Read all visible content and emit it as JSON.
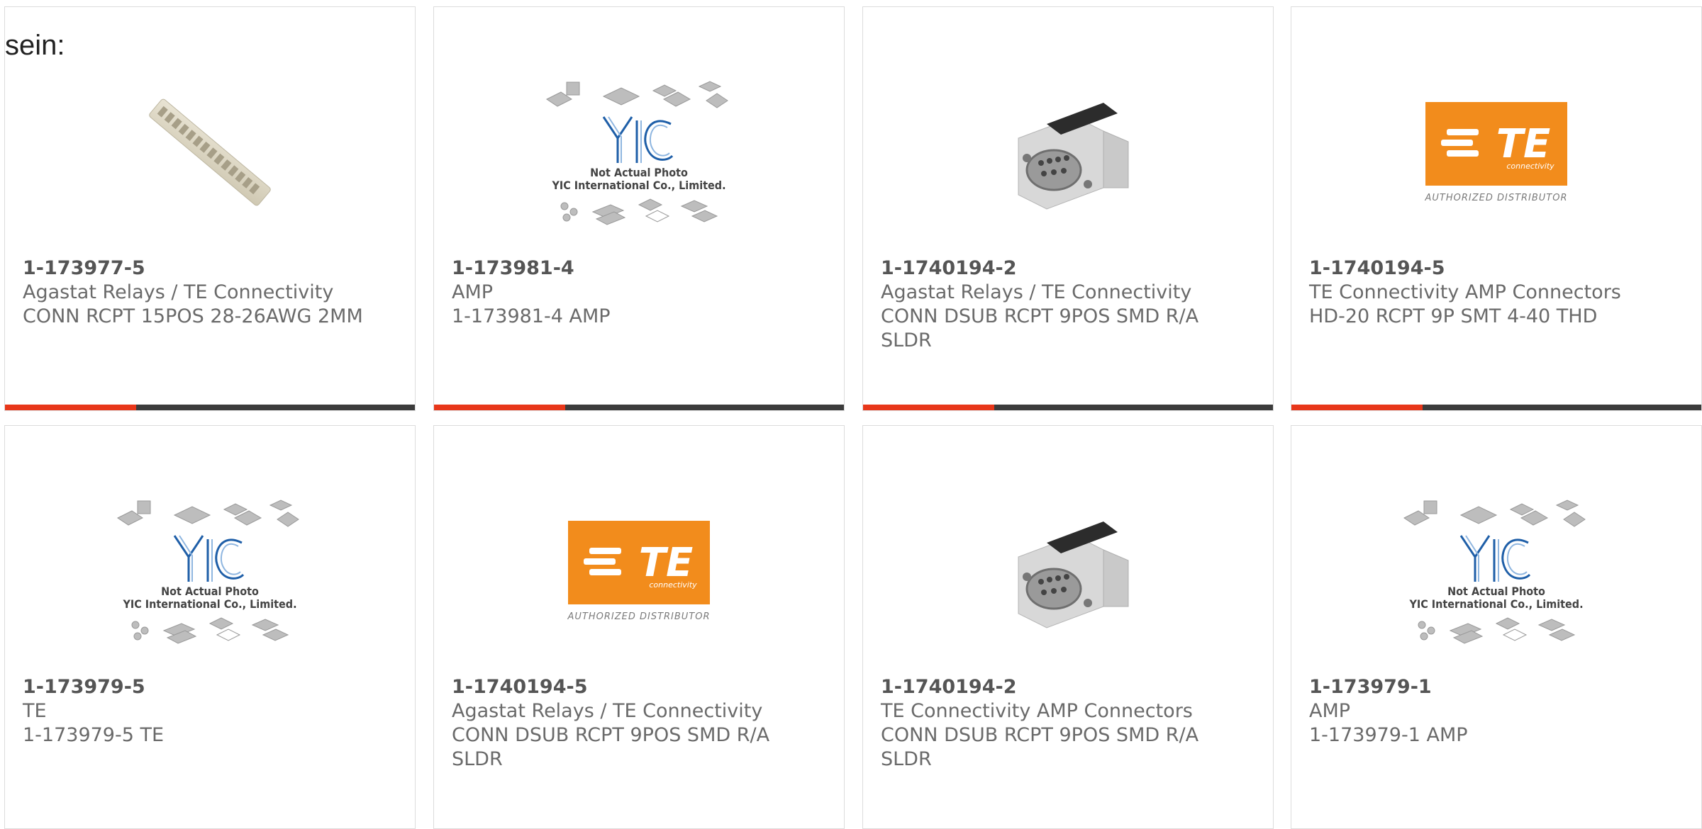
{
  "intro_text": "sein:",
  "colors": {
    "accent": "#e8371a",
    "bar_dark": "#3c3c3c",
    "te_orange": "#f28c1c",
    "yic_blue": "#1f5fa8"
  },
  "cards": [
    {
      "part_number": "1-173977-5",
      "manufacturer": "Agastat Relays / TE Connectivity",
      "description": "CONN RCPT 15POS 28-26AWG 2MM",
      "image": "strip-connector-photo",
      "progress_fraction": 0.32
    },
    {
      "part_number": "1-173981-4",
      "manufacturer": "AMP",
      "description": "1-173981-4 AMP",
      "image": "yic-placeholder",
      "placeholder_line1": "Not Actual Photo",
      "placeholder_line2": "YIC International Co., Limited.",
      "progress_fraction": 0.32
    },
    {
      "part_number": "1-1740194-2",
      "manufacturer": "Agastat Relays / TE Connectivity",
      "description": "CONN DSUB RCPT 9POS SMD R/A SLDR",
      "image": "dsub-connector-photo",
      "progress_fraction": 0.32
    },
    {
      "part_number": "1-1740194-5",
      "manufacturer": "TE Connectivity AMP Connectors",
      "description": "HD-20 RCPT 9P SMT 4-40 THD",
      "image": "te-logo",
      "logo_text": "TE",
      "logo_sub": "connectivity",
      "logo_caption": "AUTHORIZED DISTRIBUTOR",
      "progress_fraction": 0.32
    },
    {
      "part_number": "1-173979-5",
      "manufacturer": "TE",
      "description": "1-173979-5 TE",
      "image": "yic-placeholder",
      "placeholder_line1": "Not Actual Photo",
      "placeholder_line2": "YIC International Co., Limited."
    },
    {
      "part_number": "1-1740194-5",
      "manufacturer": "Agastat Relays / TE Connectivity",
      "description": "CONN DSUB RCPT 9POS SMD R/A SLDR",
      "image": "te-logo",
      "logo_text": "TE",
      "logo_sub": "connectivity",
      "logo_caption": "AUTHORIZED DISTRIBUTOR"
    },
    {
      "part_number": "1-1740194-2",
      "manufacturer": "TE Connectivity AMP Connectors",
      "description": "CONN DSUB RCPT 9POS SMD R/A SLDR",
      "image": "dsub-connector-photo"
    },
    {
      "part_number": "1-173979-1",
      "manufacturer": "AMP",
      "description": "1-173979-1 AMP",
      "image": "yic-placeholder",
      "placeholder_line1": "Not Actual Photo",
      "placeholder_line2": "YIC International Co., Limited."
    }
  ]
}
